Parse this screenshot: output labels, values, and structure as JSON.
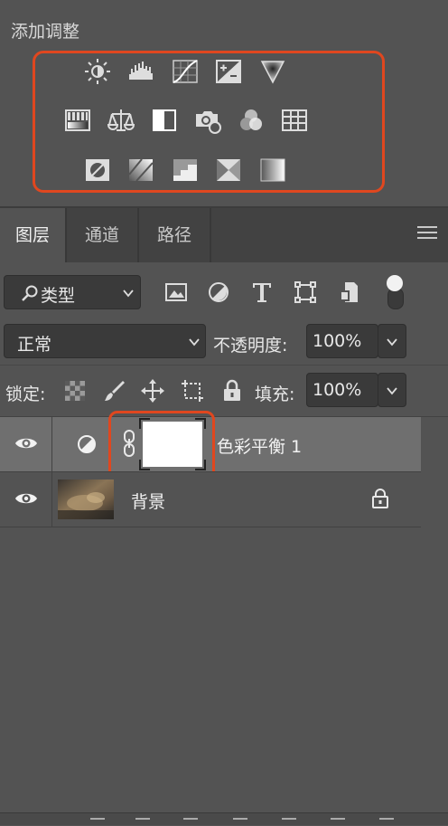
{
  "adjustments": {
    "title": "添加调整",
    "rows": [
      [
        "brightness-contrast-icon",
        "levels-icon",
        "curves-icon",
        "exposure-icon",
        "gradient-map-triangle-icon"
      ],
      [
        "vibrance-icon",
        "color-balance-icon",
        "black-white-icon",
        "photo-filter-icon",
        "channel-mixer-icon",
        "color-lookup-icon"
      ],
      [
        "invert-icon",
        "posterize-icon",
        "threshold-icon",
        "selective-color-icon",
        "gradient-map-icon"
      ]
    ]
  },
  "tabs": [
    {
      "label": "图层",
      "active": true
    },
    {
      "label": "通道",
      "active": false
    },
    {
      "label": "路径",
      "active": false
    }
  ],
  "filter": {
    "kind_label": "类型",
    "icons": [
      "image-filter-icon",
      "adjustment-filter-icon",
      "type-filter-icon",
      "shape-filter-icon",
      "smart-object-filter-icon"
    ]
  },
  "blend": {
    "mode": "正常",
    "opacity_label": "不透明度:",
    "opacity": "100%"
  },
  "lock": {
    "label": "锁定:",
    "icons": [
      "lock-transparent-pixels-icon",
      "lock-image-pixels-icon",
      "lock-position-icon",
      "lock-artboard-icon",
      "lock-all-icon"
    ],
    "fill_label": "填充:",
    "fill": "100%"
  },
  "layers": [
    {
      "name": "色彩平衡 1",
      "type": "adjustment",
      "selected": true,
      "visible": true
    },
    {
      "name": "背景",
      "type": "background",
      "selected": false,
      "visible": true,
      "locked": true
    }
  ],
  "colors": {
    "panel_bg": "#535353",
    "highlight": "#e0471f",
    "selected_row": "#6f6f6f"
  }
}
